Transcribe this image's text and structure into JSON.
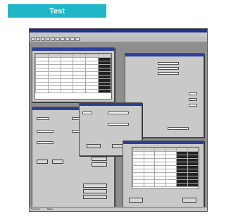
{
  "badge": {
    "label": "Test"
  },
  "screenshot": {
    "status_bar": [
      {
        "text": "Test name"
      },
      {
        "text": "Status"
      }
    ]
  },
  "colors": {
    "badge": "#1fb7c7",
    "title_bar": "#1e2f8c"
  }
}
